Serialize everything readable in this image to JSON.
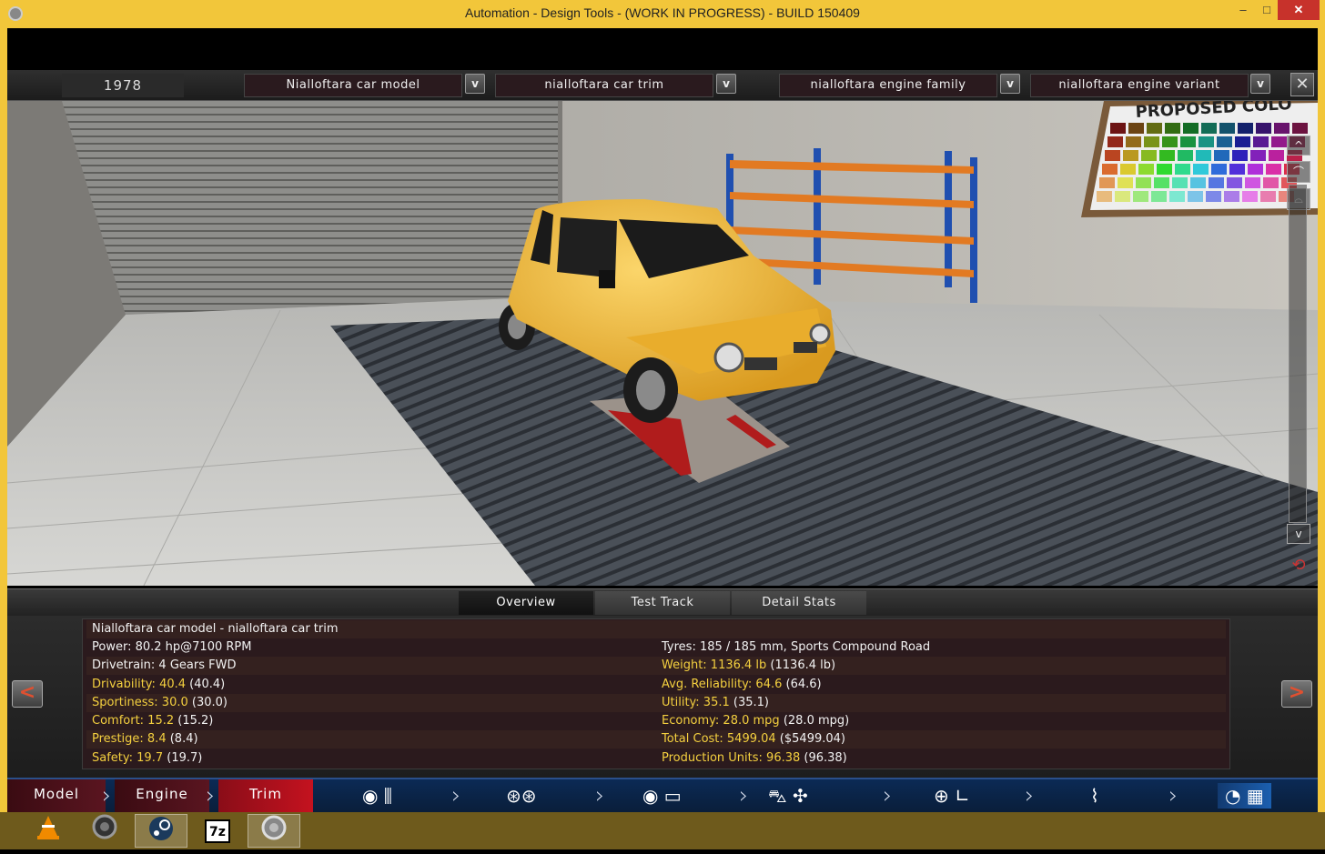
{
  "window": {
    "title": "Automation - Design Tools - (WORK IN PROGRESS) - BUILD 150409",
    "minimize_label": "–",
    "maximize_label": "□",
    "close_label": "✕"
  },
  "selectors": {
    "year": "1978",
    "model": "Nialloftara car  model",
    "trim": "nialloftara car trim",
    "engine_family": "nialloftara engine family",
    "engine_variant": "nialloftara engine variant",
    "dropdown_symbol": "v",
    "close_symbol": "✕"
  },
  "viewport": {
    "poster_text": "PROPOSED COLO",
    "scroll_up": "^",
    "scroll_down": "v",
    "colors": {
      "car_body": "#f2b83a",
      "shelf_orange": "#e27a22",
      "shelf_blue": "#1f4fb0",
      "lift_red": "#b01c1c"
    }
  },
  "tabs": [
    {
      "label": "Overview",
      "active": true
    },
    {
      "label": "Test Track",
      "active": false
    },
    {
      "label": "Detail Stats",
      "active": false
    }
  ],
  "stats": {
    "heading": "Nialloftara car  model - nialloftara car trim",
    "power": "Power: 80.2 hp@7100 RPM",
    "drivetrain": "Drivetrain: 4 Gears FWD",
    "tyres": "Tyres: 185 / 185 mm, Sports Compound Road",
    "left": [
      {
        "label": "Drivability: 40.4",
        "extra": " (40.4)"
      },
      {
        "label": "Sportiness: 30.0",
        "extra": " (30.0)"
      },
      {
        "label": "Comfort: 15.2",
        "extra": " (15.2)"
      },
      {
        "label": "Prestige: 8.4",
        "extra": " (8.4)"
      },
      {
        "label": "Safety: 19.7",
        "extra": " (19.7)"
      }
    ],
    "right": [
      {
        "label": "Weight: 1136.4 lb",
        "extra": " (1136.4 lb)"
      },
      {
        "label": "Avg. Reliability: 64.6",
        "extra": " (64.6)"
      },
      {
        "label": "Utility: 35.1",
        "extra": " (35.1)"
      },
      {
        "label": "Economy: 28.0 mpg",
        "extra": " (28.0 mpg)"
      },
      {
        "label": "Total Cost: 5499.04",
        "extra": " ($5499.04)"
      },
      {
        "label": "Production Units: 96.38",
        "extra": " (96.38)"
      }
    ],
    "prev_label": "<",
    "next_label": ">"
  },
  "nav": {
    "model": "Model",
    "engine": "Engine",
    "trim": "Trim",
    "icons": [
      "gearbox-icon",
      "wheels-icon",
      "tyre-body-icon",
      "aero-fan-icon",
      "steering-seat-icon",
      "suspension-icon",
      "testing-flag-icon"
    ]
  },
  "taskbar": {
    "apps": [
      "vlc-icon",
      "automation-icon",
      "steam-icon",
      "7zip-icon",
      "automation-window-icon"
    ],
    "sevenzip_label": "7z"
  }
}
